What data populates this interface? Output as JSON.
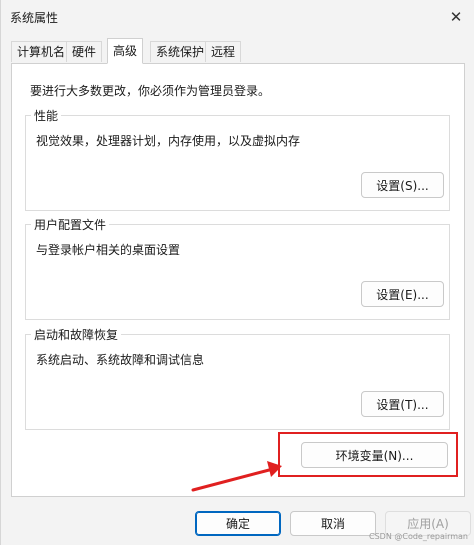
{
  "window": {
    "title": "系统属性",
    "close_glyph": "✕"
  },
  "tabs": [
    {
      "label": "计算机名",
      "active": false
    },
    {
      "label": "硬件",
      "active": false
    },
    {
      "label": "高级",
      "active": true
    },
    {
      "label": "系统保护",
      "active": false
    },
    {
      "label": "远程",
      "active": false
    }
  ],
  "panel": {
    "notice": "要进行大多数更改，你必须作为管理员登录。",
    "performance": {
      "title": "性能",
      "description": "视觉效果，处理器计划，内存使用，以及虚拟内存",
      "button": "设置(S)..."
    },
    "user_profiles": {
      "title": "用户配置文件",
      "description": "与登录帐户相关的桌面设置",
      "button": "设置(E)..."
    },
    "startup_recovery": {
      "title": "启动和故障恢复",
      "description": "系统启动、系统故障和调试信息",
      "button": "设置(T)..."
    },
    "env_button": "环境变量(N)..."
  },
  "footer": {
    "ok": "确定",
    "cancel": "取消",
    "apply": "应用(A)"
  },
  "annotation": {
    "color": "#e02020"
  },
  "watermark": "CSDN @Code_repairman"
}
